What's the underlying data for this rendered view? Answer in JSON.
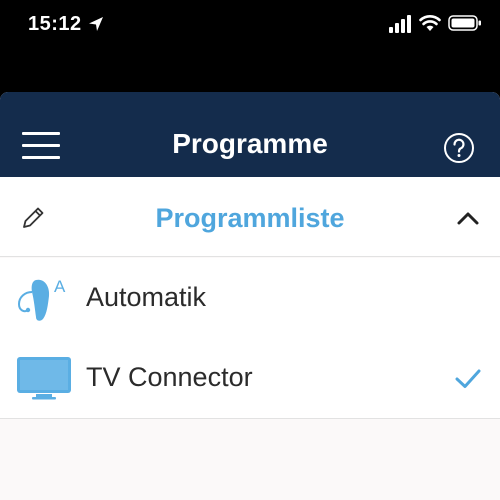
{
  "status_bar": {
    "time": "15:12",
    "icons": [
      "location-arrow-icon",
      "cellular-signal-icon",
      "wifi-icon",
      "battery-icon"
    ]
  },
  "navbar": {
    "title": "Programme",
    "left_icon": "hamburger-menu-icon",
    "right_icon": "help-icon",
    "background_color": "#142c4c"
  },
  "program_list": {
    "title": "Programmliste",
    "title_color": "#4fa6dd",
    "left_icon": "pencil-edit-icon",
    "right_icon": "chevron-up-icon",
    "items": [
      {
        "label": "Automatik",
        "icon": "hearing-aid-icon",
        "icon_badge": "A",
        "selected": false
      },
      {
        "label": "TV Connector",
        "icon": "tv-icon",
        "selected": true
      }
    ],
    "selected_check_icon": "checkmark-icon"
  }
}
